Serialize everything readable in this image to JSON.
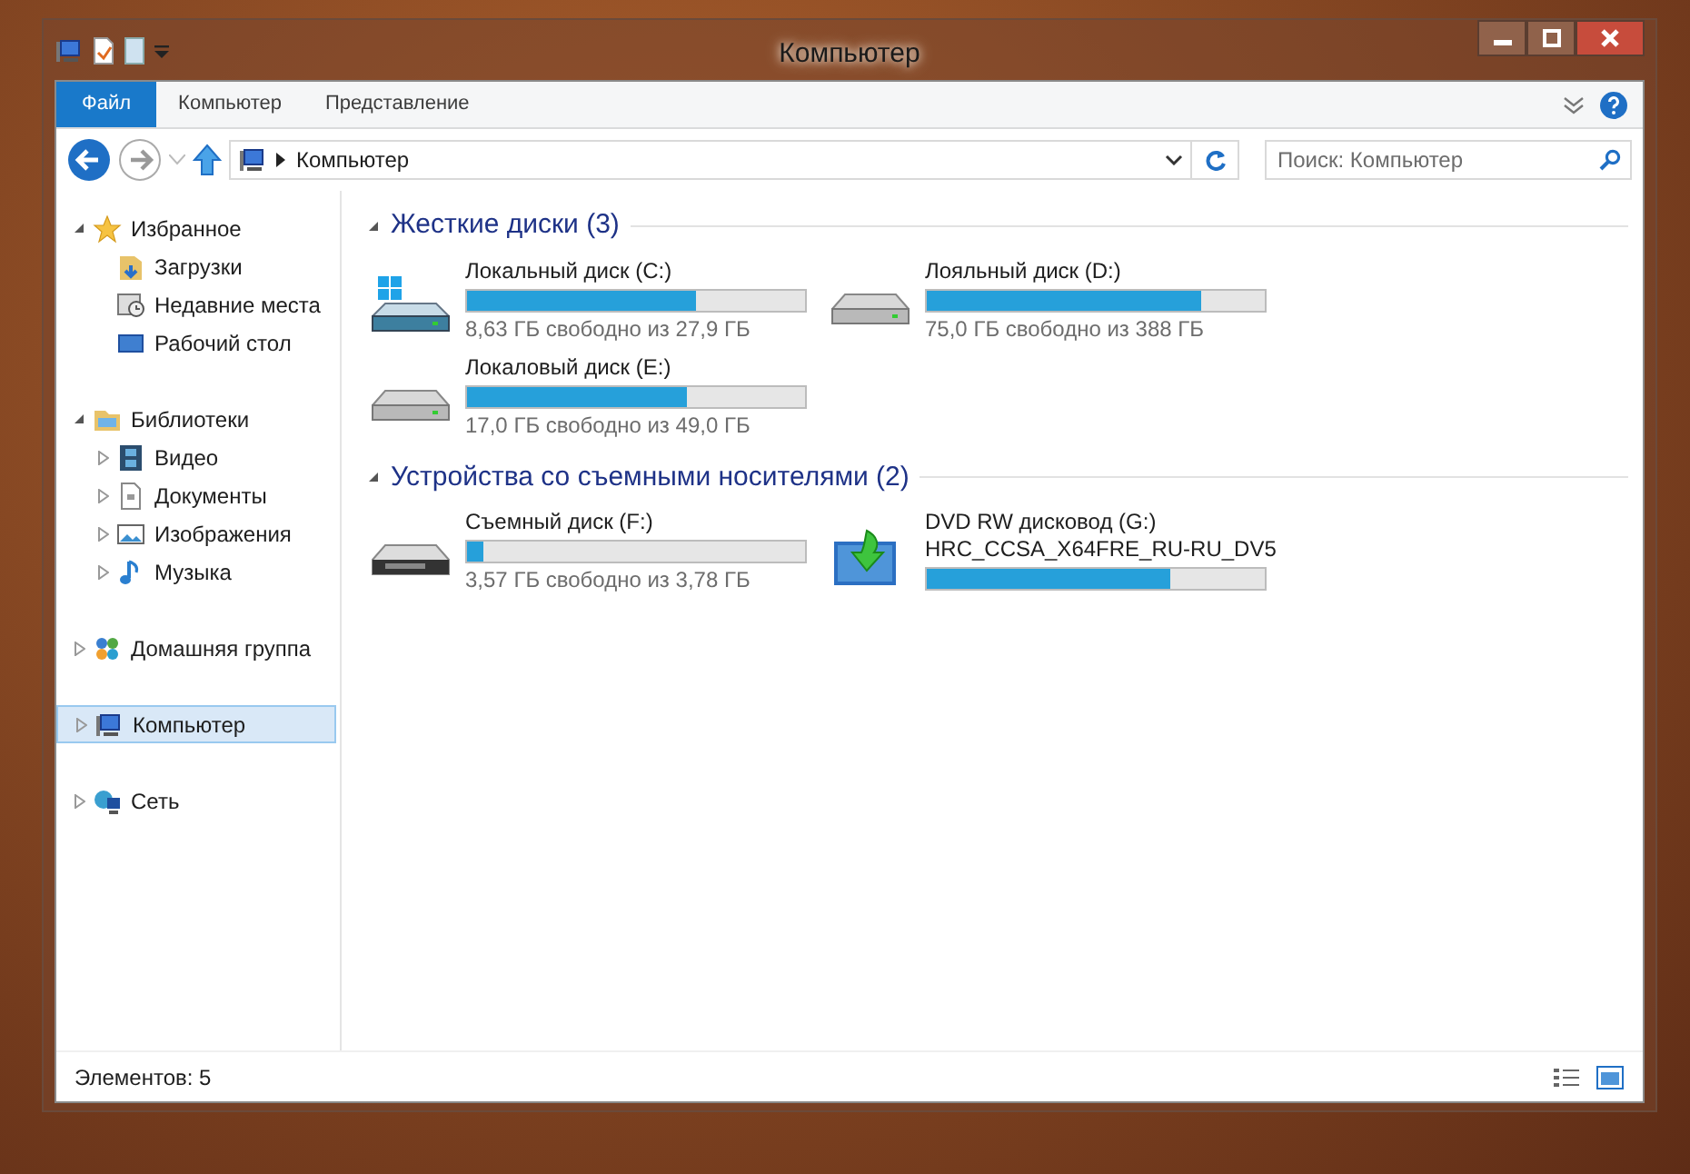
{
  "window": {
    "title": "Компьютер"
  },
  "ribbon": {
    "tabs": [
      {
        "label": "Файл",
        "selected": true,
        "kind": "file"
      },
      {
        "label": "Компьютер",
        "selected": false,
        "kind": "tab"
      },
      {
        "label": "Представление",
        "selected": false,
        "kind": "tab"
      }
    ]
  },
  "address": {
    "path": "Компьютер"
  },
  "search": {
    "placeholder": "Поиск: Компьютер"
  },
  "sidebar": {
    "items": [
      {
        "label": "Избранное",
        "kind": "star",
        "expanded": true,
        "selected": false,
        "children": [
          {
            "label": "Загрузки",
            "kind": "downloads",
            "selected": false
          },
          {
            "label": "Недавние места",
            "kind": "recent",
            "selected": false
          },
          {
            "label": "Рабочий стол",
            "kind": "desktop",
            "selected": false
          }
        ]
      },
      {
        "label": "Библиотеки",
        "kind": "libraries",
        "expanded": true,
        "selected": false,
        "children": [
          {
            "label": "Видео",
            "kind": "video",
            "expanded": false,
            "selected": false
          },
          {
            "label": "Документы",
            "kind": "documents",
            "expanded": false,
            "selected": false
          },
          {
            "label": "Изображения",
            "kind": "pictures",
            "expanded": false,
            "selected": false
          },
          {
            "label": "Музыка",
            "kind": "music",
            "expanded": false,
            "selected": false
          }
        ]
      },
      {
        "label": "Домашняя группа",
        "kind": "homegroup",
        "expanded": false,
        "selected": false
      },
      {
        "label": "Компьютер",
        "kind": "computer",
        "expanded": false,
        "selected": true
      },
      {
        "label": "Сеть",
        "kind": "network",
        "expanded": false,
        "selected": false
      }
    ]
  },
  "sections": [
    {
      "title": "Жесткие диски (3)",
      "expanded": true,
      "drives": [
        {
          "kind": "system",
          "name": "Локальный диск (C:)",
          "level": 0.68,
          "free": "8,63 ГБ свободно из 27,9 ГБ"
        },
        {
          "kind": "hdd",
          "name": "Лояльный диск (D:)",
          "level": 0.81,
          "free": "75,0 ГБ свободно из 388 ГБ"
        },
        {
          "kind": "hdd",
          "name": "Локаловый диск (E:)",
          "level": 0.65,
          "free": "17,0 ГБ свободно из 49,0 ГБ"
        }
      ]
    },
    {
      "title": "Устройства со съемными носителями (2)",
      "expanded": true,
      "drives": [
        {
          "kind": "removable",
          "name": "Съемный диск (F:)",
          "level": 0.05,
          "free": "3,57 ГБ свободно из 3,78 ГБ"
        },
        {
          "kind": "dvd",
          "name": "DVD RW дисковод (G:)",
          "volume": "HRC_CCSA_X64FRE_RU-RU_DV5",
          "level": 0.72
        }
      ]
    }
  ],
  "status_bar": {
    "count": "Элементов: 5"
  }
}
